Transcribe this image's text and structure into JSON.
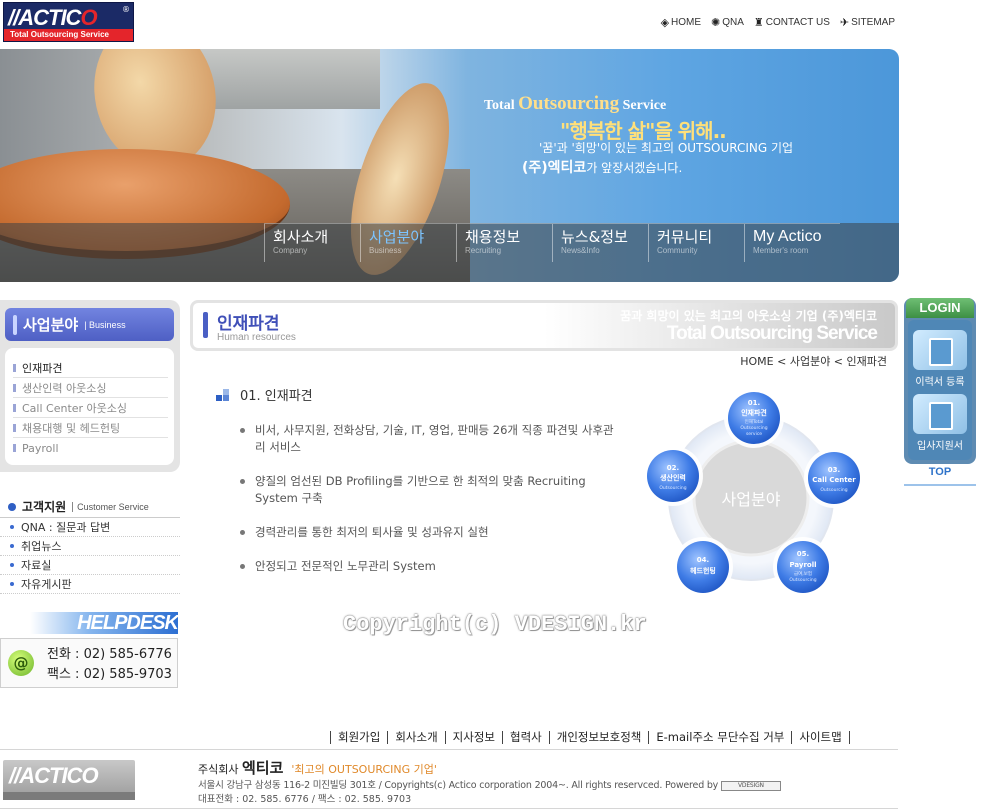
{
  "logo": {
    "mark_a": "//ACTIC",
    "mark_b": "O",
    "tagline": "Total Outsourcing Service",
    "reg": "®"
  },
  "top_nav": [
    {
      "icon": "home-icon",
      "glyph": "◈",
      "label": "HOME"
    },
    {
      "icon": "qna-icon",
      "glyph": "✺",
      "label": "QNA"
    },
    {
      "icon": "contact-icon",
      "glyph": "♜",
      "label": "CONTACT US"
    },
    {
      "icon": "sitemap-icon",
      "glyph": "✈",
      "label": "SITEMAP"
    }
  ],
  "hero": {
    "line1_pre": "Total ",
    "line1_big": "Outsourcing",
    "line1_post": " Service",
    "line2": "\"행복한 삶\"을 위해..",
    "line3": "'꿈'과 '희망'이 있는 최고의 OUTSOURCING 기업",
    "line4_big": "(주)엑티코",
    "line4_small": "가 앞장서겠습니다."
  },
  "gnb": [
    {
      "ko": "회사소개",
      "en": "Company",
      "active": false
    },
    {
      "ko": "사업분야",
      "en": "Business",
      "active": true
    },
    {
      "ko": "채용정보",
      "en": "Recruiting",
      "active": false
    },
    {
      "ko": "뉴스&정보",
      "en": "News&Info",
      "active": false
    },
    {
      "ko": "커뮤니티",
      "en": "Community",
      "active": false
    },
    {
      "ko": "My Actico",
      "en": "Member's room",
      "active": false
    }
  ],
  "left_menu": {
    "title_ko": "사업분야",
    "title_en": "Business",
    "items": [
      "인재파견",
      "생산인력 아웃소싱",
      "Call Center 아웃소싱",
      "채용대행 및 헤드헌팅",
      "Payroll"
    ]
  },
  "customer": {
    "title_ko": "고객지원",
    "title_en": "Customer Service",
    "items": [
      "QNA : 질문과 답변",
      "취업뉴스",
      "자료실",
      "자유게시판"
    ]
  },
  "helpdesk": {
    "title": "HELPDESK",
    "icon_glyph": "@",
    "phone": "전화 : 02) 585-6776",
    "fax": "팩스 : 02) 585-9703"
  },
  "content_title": {
    "ko": "인재파견",
    "en": "Human resources",
    "right1": "꿈과 희망이 있는 최고의 아웃소싱 기업 (주)엑티코",
    "right2": "Total Outsourcing Service"
  },
  "breadcrumb": "HOME < 사업분야 < 인재파견",
  "section_title": "01. 인재파견",
  "bullets": [
    "비서, 사무지원, 전화상담, 기술, IT, 영업, 판매등 26개 직종 파견및 사후관리 서비스",
    "양질의 엄선된 DB Profiling를 기반으로 한 최적의 맞춤 Recruiting System 구축",
    "경력관리를 통한 최저의 퇴사율 및 성과유지 실현",
    "안정되고 전문적인 노무관리 System"
  ],
  "diagram": {
    "center": "사업분야",
    "nodes": [
      {
        "num": "01.",
        "ko": "인재파견",
        "en1": "인재Total",
        "en2": "Outsourcing",
        "en3": "service"
      },
      {
        "num": "02.",
        "ko": "생산인력",
        "en1": "Outsourcing",
        "en2": "",
        "en3": ""
      },
      {
        "num": "03.",
        "ko": "Call Center",
        "en1": "Outsourcing",
        "en2": "",
        "en3": ""
      },
      {
        "num": "04.",
        "ko": "헤드헌팅",
        "en1": "",
        "en2": "",
        "en3": ""
      },
      {
        "num": "05.",
        "ko": "Payroll",
        "en1": "급여,보험",
        "en2": "Outsourcing",
        "en3": ""
      }
    ]
  },
  "watermark": "Copyright(c) VDESIGN.kr",
  "right_side": {
    "login": "LOGIN",
    "btn1": "이력서 등록",
    "btn2": "입사지원서",
    "top": "TOP"
  },
  "footer_nav": [
    "회원가입",
    "회사소개",
    "지사정보",
    "협력사",
    "개인정보보호정책",
    "E-mail주소 무단수집 거부",
    "사이트맵"
  ],
  "footer": {
    "company_prefix": "주식회사",
    "company_name": "엑티코",
    "slogan": "'최고의 OUTSOURCING 기업'",
    "address": "서울시 강남구 삼성동 116-2 미진빌딩 301호  / Copyrights(c) Actico corporation 2004~. All rights reservced. Powered by",
    "vdesign": "VDESIGN",
    "phones": "대표전화 : 02. 585. 6776 / 팩스 : 02. 585. 9703"
  },
  "colors": {
    "brand_navy": "#1b2a66",
    "brand_red": "#e4252b",
    "accent_blue": "#4a5fc4",
    "gnb_active": "#7cc4ff"
  }
}
